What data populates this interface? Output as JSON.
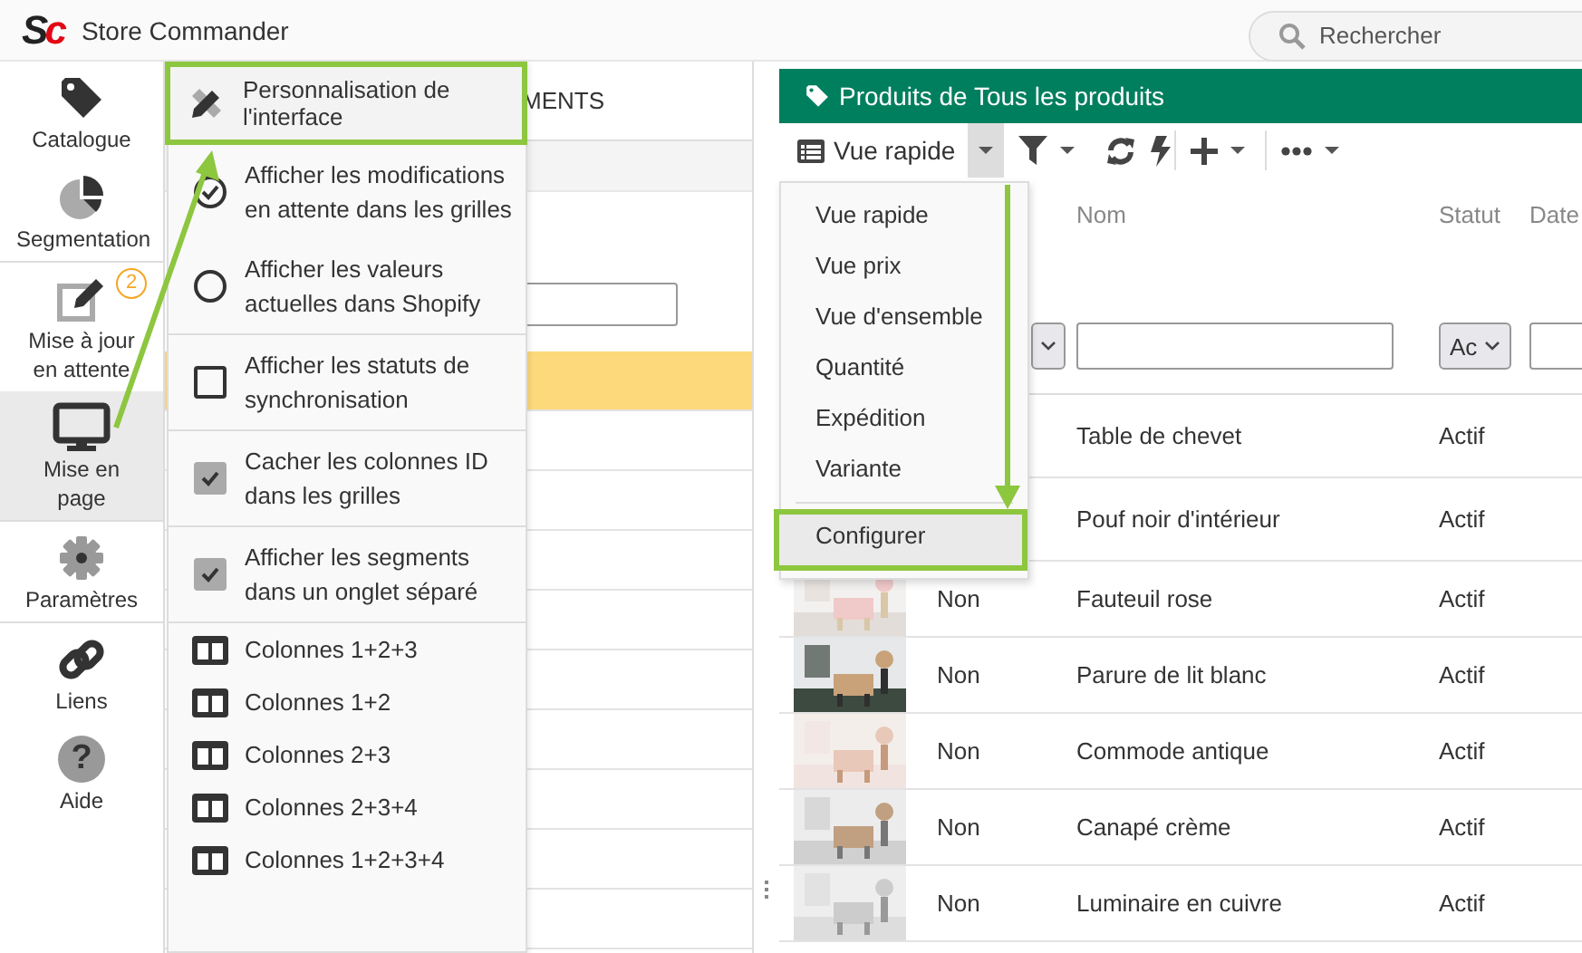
{
  "app": {
    "logo": [
      "S",
      "c"
    ],
    "title": "Store Commander"
  },
  "search": {
    "placeholder": "Rechercher"
  },
  "sidebar": {
    "items": [
      {
        "label": "Catalogue",
        "selected": false
      },
      {
        "label": "Segmentation",
        "selected": false
      },
      {
        "label": "Mise à jour en attente",
        "selected": false,
        "badge": "2"
      },
      {
        "label": "Mise en page",
        "selected": true
      },
      {
        "label": "Paramètres",
        "selected": false
      },
      {
        "label": "Liens",
        "selected": false
      },
      {
        "label": "Aide",
        "selected": false,
        "glyph": "?"
      }
    ]
  },
  "middle_panel": {
    "tab_label": "MENTS",
    "rows": [
      {
        "selected": true
      },
      {
        "selected": false
      },
      {
        "selected": false
      },
      {
        "selected": false
      },
      {
        "selected": false
      },
      {
        "selected": false
      },
      {
        "selected": false
      },
      {
        "selected": false
      },
      {
        "selected": false
      },
      {
        "selected": false
      }
    ]
  },
  "settings_menu": {
    "header": {
      "label": "Personnalisation de l'interface",
      "highlighted": true
    },
    "items": [
      {
        "kind": "radio",
        "label": "Afficher les modifications en attente dans les grilles",
        "checked": true
      },
      {
        "kind": "radio",
        "label": "Afficher les valeurs actuelles dans Shopify",
        "checked": false
      },
      {
        "kind": "checkbox",
        "label": "Afficher les statuts de synchronisation",
        "checked": false
      },
      {
        "kind": "checkbox",
        "label": "Cacher les colonnes ID dans les grilles",
        "checked": true
      },
      {
        "kind": "checkbox",
        "label": "Afficher les segments dans un onglet séparé",
        "checked": true
      },
      {
        "kind": "layout",
        "label": "Colonnes 1+2+3"
      },
      {
        "kind": "layout",
        "label": "Colonnes 1+2"
      },
      {
        "kind": "layout",
        "label": "Colonnes 2+3"
      },
      {
        "kind": "layout",
        "label": "Colonnes 2+3+4"
      },
      {
        "kind": "layout",
        "label": "Colonnes 1+2+3+4"
      }
    ]
  },
  "products_panel": {
    "title": "Produits de Tous les produits",
    "toolbar": {
      "view_button": "Vue rapide"
    },
    "columns": [
      "Nom",
      "Statut",
      "Date"
    ],
    "filters": {
      "status_select": "Ac"
    },
    "rows": [
      {
        "name": "Table de chevet",
        "status": "Actif"
      },
      {
        "name": "Pouf noir d'intérieur",
        "status": "Actif"
      },
      {
        "published": "Non",
        "name": "Fauteuil rose",
        "status": "Actif"
      },
      {
        "published": "Non",
        "name": "Parure de lit blanc",
        "status": "Actif"
      },
      {
        "published": "Non",
        "name": "Commode antique",
        "status": "Actif"
      },
      {
        "published": "Non",
        "name": "Canapé crème",
        "status": "Actif"
      },
      {
        "published": "Non",
        "name": "Luminaire en cuivre",
        "status": "Actif"
      }
    ]
  },
  "view_menu": {
    "items": [
      {
        "kind": "view",
        "label": "Vue rapide",
        "highlighted": false
      },
      {
        "kind": "view",
        "label": "Vue prix",
        "highlighted": false
      },
      {
        "kind": "view",
        "label": "Vue d'ensemble",
        "highlighted": false
      },
      {
        "kind": "view",
        "label": "Quantité",
        "highlighted": false
      },
      {
        "kind": "view",
        "label": "Expédition",
        "highlighted": false
      },
      {
        "kind": "view",
        "label": "Variante",
        "highlighted": false
      },
      {
        "kind": "action",
        "label": "Configurer",
        "highlighted": true
      }
    ]
  }
}
